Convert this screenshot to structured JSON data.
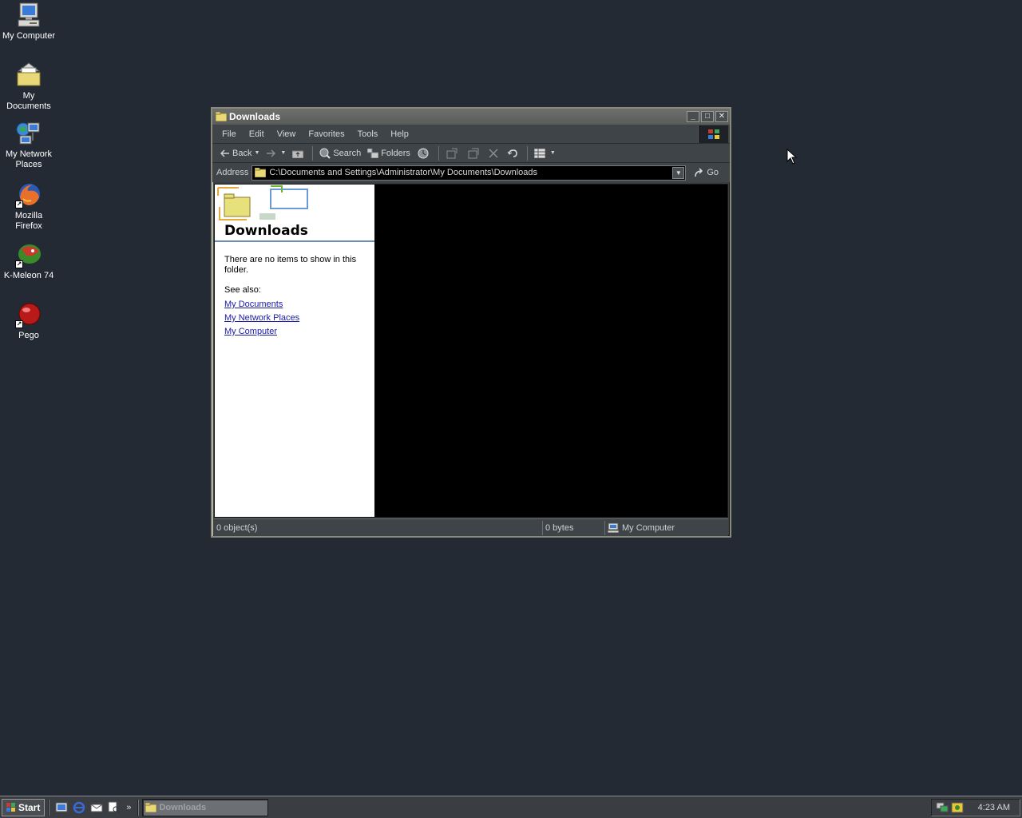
{
  "desktop": {
    "icons": [
      {
        "label": "My Computer"
      },
      {
        "label": "My Documents"
      },
      {
        "label": "My Network Places"
      },
      {
        "label": "Mozilla Firefox"
      },
      {
        "label": "K-Meleon 74"
      },
      {
        "label": "Pego"
      }
    ]
  },
  "window": {
    "title": "Downloads",
    "menu": [
      "File",
      "Edit",
      "View",
      "Favorites",
      "Tools",
      "Help"
    ],
    "toolbar": {
      "back": "Back",
      "search": "Search",
      "folders": "Folders"
    },
    "address": {
      "label": "Address",
      "value": "C:\\Documents and Settings\\Administrator\\My Documents\\Downloads",
      "go": "Go"
    },
    "taskpane": {
      "title": "Downloads",
      "empty_message": "There are no items to show in this folder.",
      "see_also": "See also:",
      "links": [
        "My Documents",
        "My Network Places",
        "My Computer"
      ]
    },
    "status": {
      "objects": "0 object(s)",
      "size": "0 bytes",
      "zone": "My Computer"
    }
  },
  "taskbar": {
    "start": "Start",
    "task": "Downloads",
    "clock": "4:23 AM",
    "more": "»"
  },
  "colors": {
    "desktop": "#232a33",
    "link": "#1a1aa8",
    "file_area": "#000000"
  }
}
